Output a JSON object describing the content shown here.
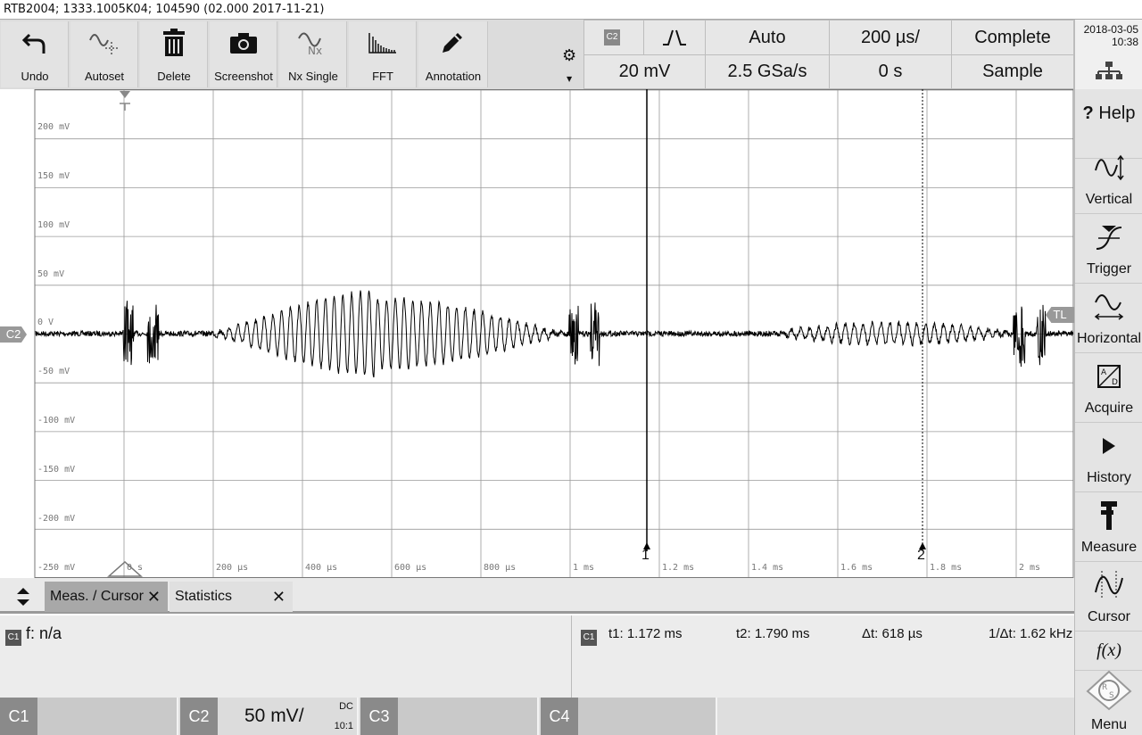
{
  "title_bar": "RTB2004; 1333.1005K04; 104590 (02.000 2017-11-21)",
  "toolbar": {
    "undo": "Undo",
    "autoset": "Autoset",
    "delete": "Delete",
    "screenshot": "Screenshot",
    "nx_single": "Nx Single",
    "fft": "FFT",
    "annotation": "Annotation"
  },
  "settings": {
    "channel_chip": "C2",
    "trigger_mode": "Auto",
    "timebase": "200 µs/",
    "acq_state": "Complete",
    "vert_scale": "20 mV",
    "sample_rate": "2.5 GSa/s",
    "time_offset": "0 s",
    "acq_mode": "Sample"
  },
  "datetime": {
    "date": "2018-03-05",
    "time": "10:38"
  },
  "grid": {
    "y_labels": [
      "200 mV",
      "150 mV",
      "100 mV",
      "50 mV",
      "0 V",
      "-50 mV",
      "-100 mV",
      "-150 mV",
      "-200 mV",
      "-250 mV"
    ],
    "x_labels": [
      "0 s",
      "200 µs",
      "400 µs",
      "600 µs",
      "800 µs",
      "1 ms",
      "1.2 ms",
      "1.4 ms",
      "1.6 ms",
      "1.8 ms",
      "2 ms"
    ],
    "channel_marker": "C2",
    "trigger_level_marker": "TL",
    "cursor1_label": "1",
    "cursor2_label": "2"
  },
  "right_menu": {
    "help": "Help",
    "vertical": "Vertical",
    "trigger": "Trigger",
    "horizontal": "Horizontal",
    "acquire": "Acquire",
    "history": "History",
    "measure": "Measure",
    "cursor": "Cursor",
    "fx": "f(x)",
    "menu": "Menu"
  },
  "tabs": {
    "meas_cursor": "Meas. / Cursor",
    "statistics": "Statistics"
  },
  "measurement": {
    "chip": "C1",
    "freq": "f: n/a"
  },
  "cursor_readout": {
    "chip": "C1",
    "t1": "t1: 1.172 ms",
    "t2": "t2: 1.790 ms",
    "dt": "Δt: 618 µs",
    "inv_dt": "1/Δt: 1.62 kHz"
  },
  "channels": {
    "c1": "C1",
    "c2": "C2",
    "c2_scale": "50 mV/",
    "c2_coupling": "DC",
    "c2_probe": "10:1",
    "c3": "C3",
    "c4": "C4"
  }
}
